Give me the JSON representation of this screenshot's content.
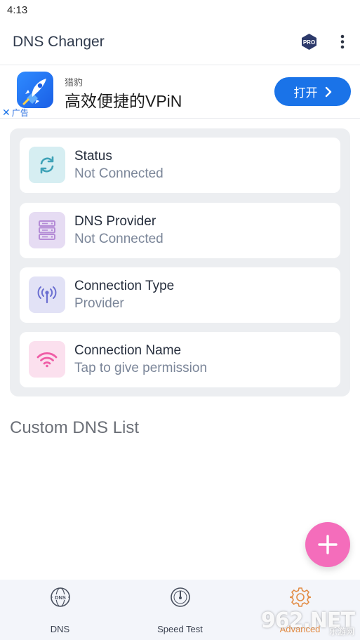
{
  "status_bar": {
    "time": "4:13"
  },
  "app_bar": {
    "title": "DNS Changer",
    "pro_badge": "PRO"
  },
  "ad": {
    "brand": "猎豹",
    "headline": "高效便捷的VPiN",
    "cta": "打开",
    "label": "广告"
  },
  "cards": [
    {
      "title": "Status",
      "value": "Not Connected",
      "icon": "sync-icon",
      "tint": "#d6eef2",
      "color": "#3fa2b7"
    },
    {
      "title": "DNS Provider",
      "value": "Not Connected",
      "icon": "server-icon",
      "tint": "#e6dcf3",
      "color": "#b48bd6"
    },
    {
      "title": "Connection Type",
      "value": "Provider",
      "icon": "broadcast-icon",
      "tint": "#e2e2f6",
      "color": "#6b6fd1"
    },
    {
      "title": "Connection Name",
      "value": "Tap to give permission",
      "icon": "wifi-icon",
      "tint": "#fbe0ee",
      "color": "#ef5da6"
    }
  ],
  "section": {
    "custom_dns_title": "Custom DNS List"
  },
  "fab": {
    "icon": "plus-icon",
    "color": "#f46dbb"
  },
  "bottom_nav": [
    {
      "label": "DNS",
      "icon": "dns-globe-icon"
    },
    {
      "label": "Speed Test",
      "icon": "speedometer-icon"
    },
    {
      "label": "Advanced",
      "icon": "gear-icon"
    }
  ],
  "watermark": {
    "text": "962.NET",
    "sub": "乐游网"
  }
}
